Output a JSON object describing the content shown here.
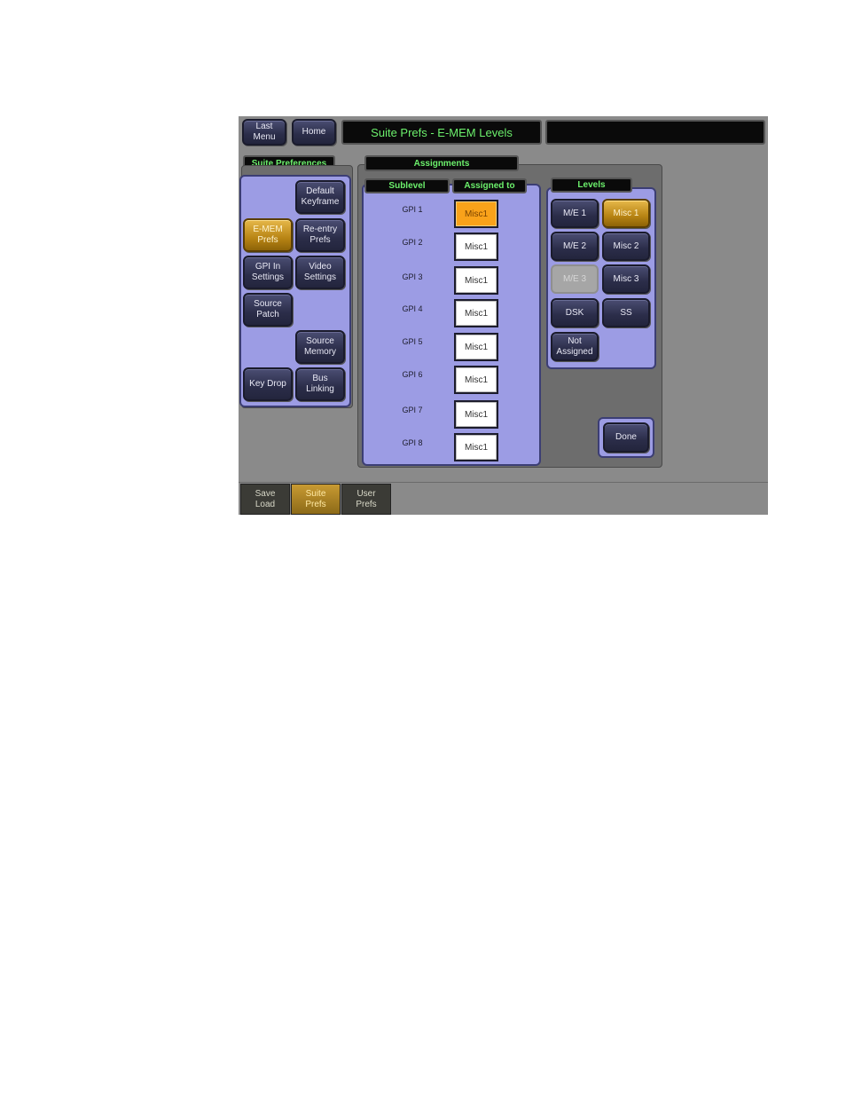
{
  "header": {
    "last_menu_label": "Last\nMenu",
    "home_label": "Home",
    "title": "Suite Prefs - E-MEM Levels",
    "status": ""
  },
  "suite_preferences": {
    "heading": "Suite Preferences",
    "items": [
      {
        "label": "Default\nKeyframe",
        "active": false
      },
      {
        "label": "E-MEM\nPrefs",
        "active": true
      },
      {
        "label": "Re-entry\nPrefs",
        "active": false
      },
      {
        "label": "GPI In\nSettings",
        "active": false
      },
      {
        "label": "Video\nSettings",
        "active": false
      },
      {
        "label": "Source\nPatch",
        "active": false
      },
      {
        "label": "Source\nMemory",
        "active": false
      },
      {
        "label": "Key Drop",
        "active": false
      },
      {
        "label": "Bus\nLinking",
        "active": false
      }
    ]
  },
  "assignments": {
    "heading": "Assignments",
    "col_sublevel": "Sublevel",
    "col_assigned": "Assigned to",
    "rows": [
      {
        "sublevel": "GPI 1",
        "assigned": "Misc1",
        "selected": true
      },
      {
        "sublevel": "GPI 2",
        "assigned": "Misc1",
        "selected": false
      },
      {
        "sublevel": "GPI 3",
        "assigned": "Misc1",
        "selected": false
      },
      {
        "sublevel": "GPI 4",
        "assigned": "Misc1",
        "selected": false
      },
      {
        "sublevel": "GPI 5",
        "assigned": "Misc1",
        "selected": false
      },
      {
        "sublevel": "GPI 6",
        "assigned": "Misc1",
        "selected": false
      },
      {
        "sublevel": "GPI 7",
        "assigned": "Misc1",
        "selected": false
      },
      {
        "sublevel": "GPI 8",
        "assigned": "Misc1",
        "selected": false
      }
    ]
  },
  "levels": {
    "heading": "Levels",
    "me1": "M/E 1",
    "misc1": "Misc 1",
    "me2": "M/E 2",
    "misc2": "Misc 2",
    "me3": "M/E 3",
    "misc3": "Misc 3",
    "dsk": "DSK",
    "ss": "SS",
    "not_assigned": "Not\nAssigned"
  },
  "done_label": "Done",
  "bottom_tabs": [
    {
      "label": "Save\nLoad",
      "active": false
    },
    {
      "label": "Suite\nPrefs",
      "active": true
    },
    {
      "label": "User\nPrefs",
      "active": false
    }
  ],
  "colors": {
    "panel": "#9c9ce4",
    "active": "#f9a21a",
    "plaque_text": "#6cf06c",
    "background": "#8a8a8a"
  }
}
